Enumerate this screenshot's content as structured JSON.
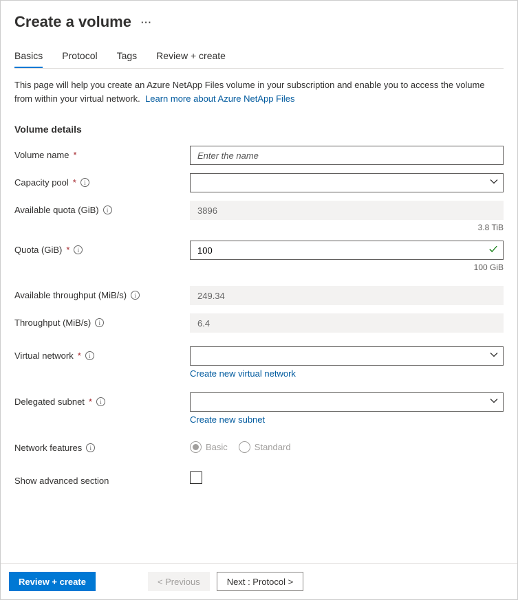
{
  "header": {
    "title": "Create a volume"
  },
  "tabs": [
    {
      "label": "Basics",
      "active": true
    },
    {
      "label": "Protocol",
      "active": false
    },
    {
      "label": "Tags",
      "active": false
    },
    {
      "label": "Review + create",
      "active": false
    }
  ],
  "intro": {
    "text": "This page will help you create an Azure NetApp Files volume in your subscription and enable you to access the volume from within your virtual network.",
    "link_text": "Learn more about Azure NetApp Files"
  },
  "section_title": "Volume details",
  "fields": {
    "volume_name": {
      "label": "Volume name",
      "required": true,
      "placeholder": "Enter the name",
      "value": ""
    },
    "capacity_pool": {
      "label": "Capacity pool",
      "required": true,
      "value": ""
    },
    "available_quota": {
      "label": "Available quota (GiB)",
      "value": "3896",
      "sub": "3.8 TiB"
    },
    "quota": {
      "label": "Quota (GiB)",
      "required": true,
      "value": "100",
      "sub": "100 GiB"
    },
    "available_throughput": {
      "label": "Available throughput (MiB/s)",
      "value": "249.34"
    },
    "throughput": {
      "label": "Throughput (MiB/s)",
      "value": "6.4"
    },
    "virtual_network": {
      "label": "Virtual network",
      "required": true,
      "value": "",
      "sub_link": "Create new virtual network"
    },
    "delegated_subnet": {
      "label": "Delegated subnet",
      "required": true,
      "value": "",
      "sub_link": "Create new subnet"
    },
    "network_features": {
      "label": "Network features",
      "options": [
        "Basic",
        "Standard"
      ],
      "selected": "Basic"
    },
    "show_advanced": {
      "label": "Show advanced section",
      "checked": false
    }
  },
  "footer": {
    "review": "Review + create",
    "previous": "< Previous",
    "next": "Next : Protocol >"
  }
}
